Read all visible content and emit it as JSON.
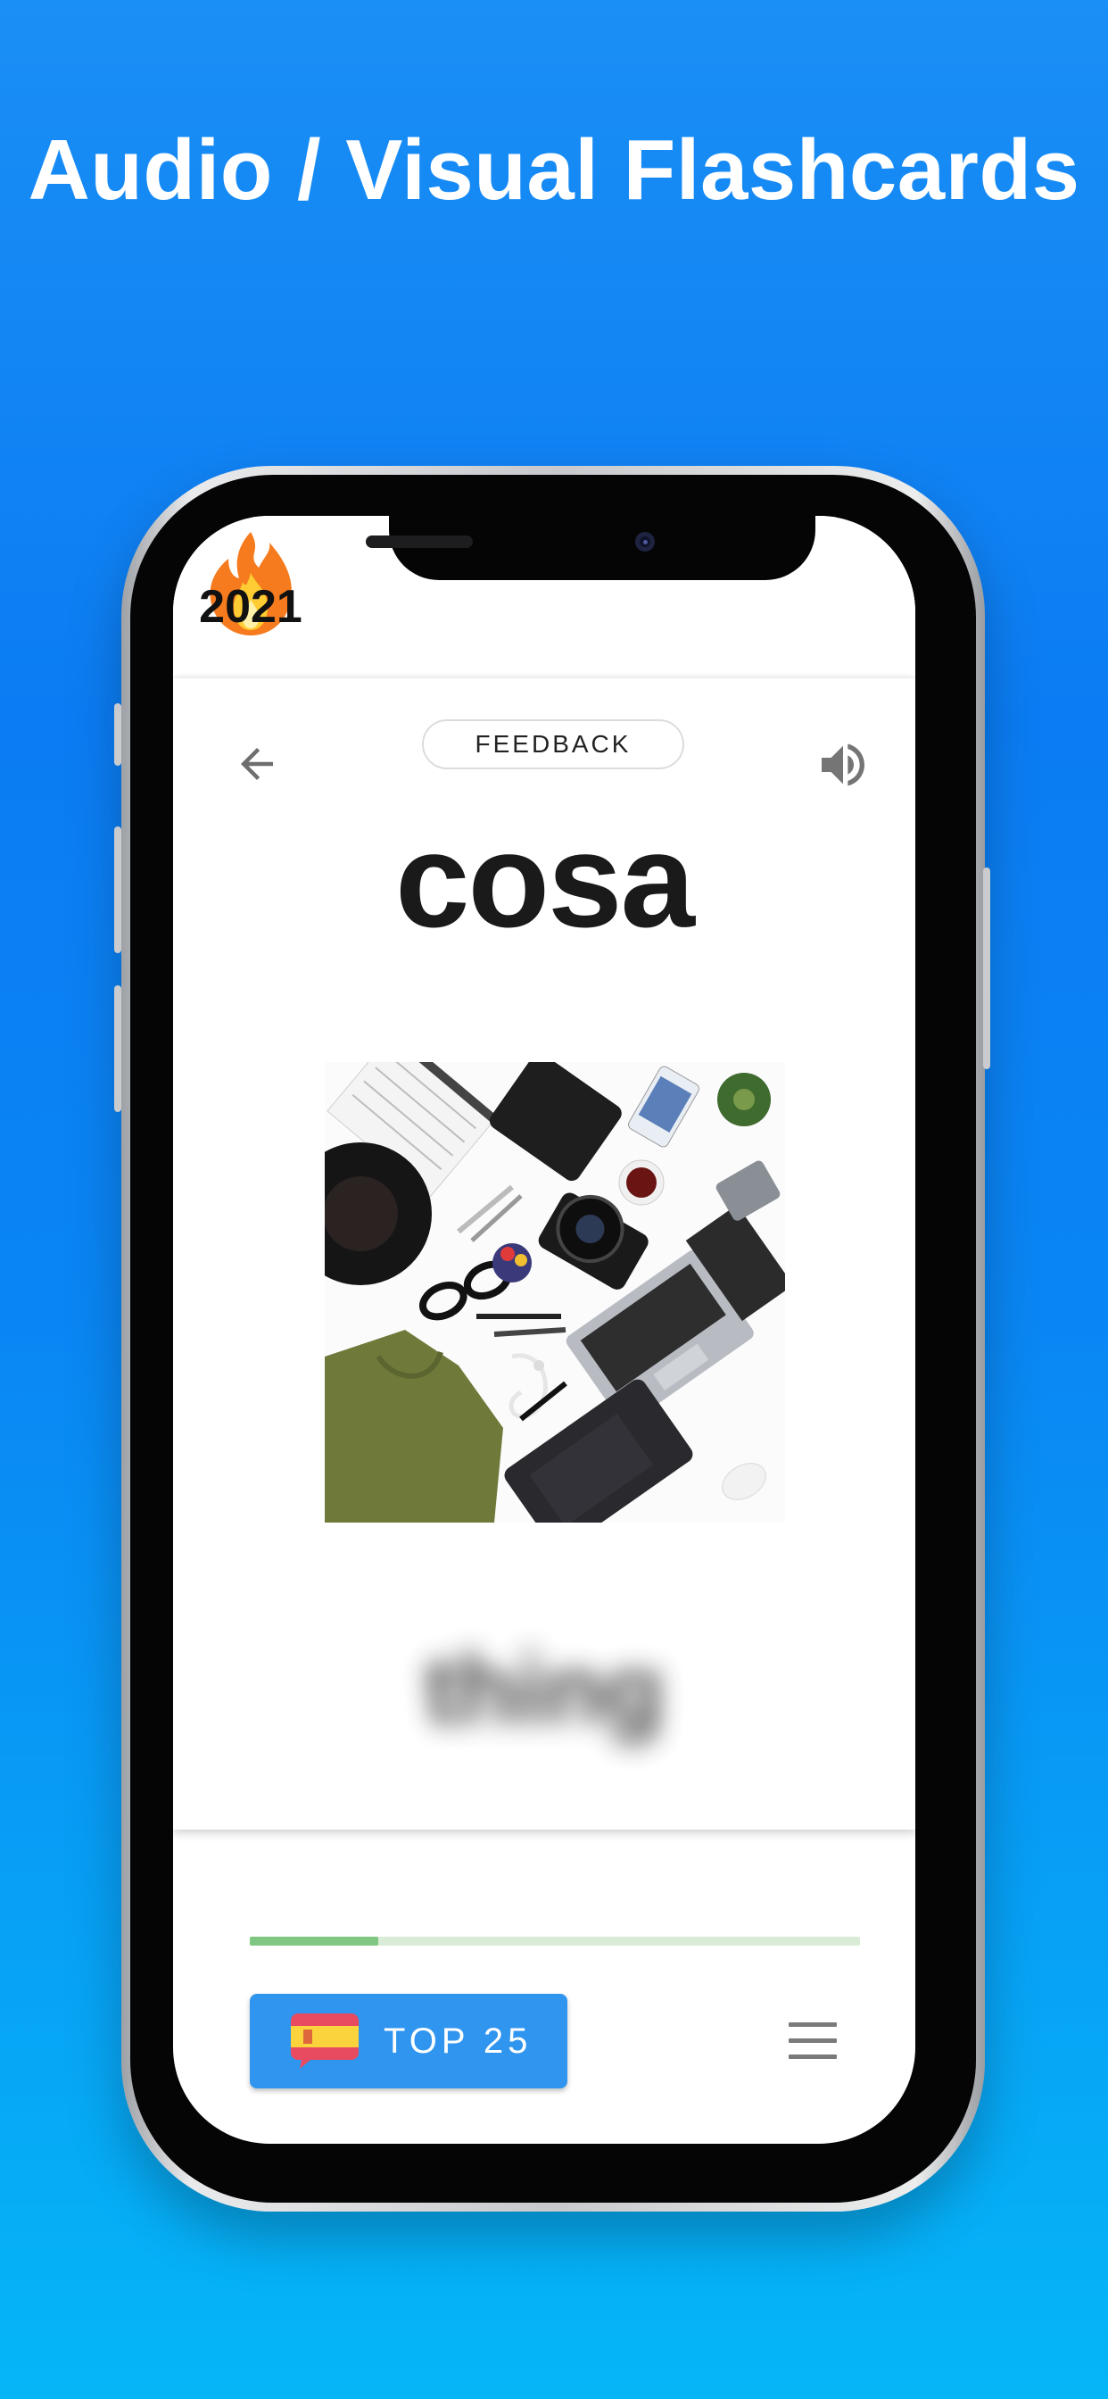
{
  "headline": "Audio / Visual Flashcards",
  "badge": {
    "year": "2021",
    "icon": "fire-emoji"
  },
  "card": {
    "back_icon": "arrow-left-icon",
    "feedback_label": "FEEDBACK",
    "sound_icon": "speaker-volume-icon",
    "word": "cosa",
    "image": "flat-lay-of-everyday-objects",
    "translation": "thing"
  },
  "progress": {
    "fraction": 0.21
  },
  "bottom_bar": {
    "deck_label": "TOP 25",
    "deck_flag": "spain-flag-speech-bubble",
    "menu_icon": "hamburger-menu-icon"
  },
  "colors": {
    "background_top": "#1a8ff5",
    "background_bottom": "#05b6f7",
    "deck_button": "#2f95ef",
    "progress_fill": "#7ec681",
    "progress_track": "#d9ecd6"
  }
}
